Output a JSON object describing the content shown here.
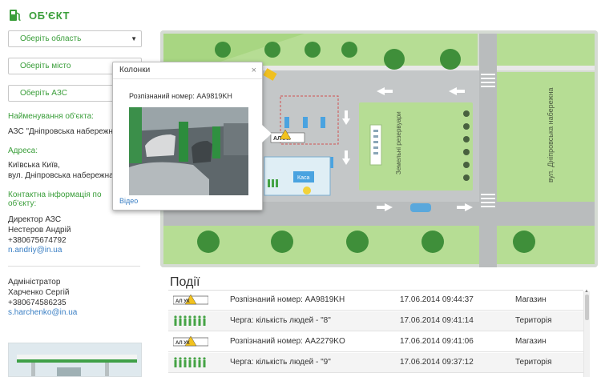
{
  "header": {
    "title": "ОБ'ЄКТ",
    "icon": "fuel-pump-icon",
    "accent": "#3a9e3a"
  },
  "filters": {
    "region": "Оберіть область",
    "city": "Оберіть місто",
    "station": "Оберіть АЗС"
  },
  "object": {
    "name_label": "Найменування об'єкта:",
    "name_value": "АЗС \"Дніпровська набережна\"",
    "address_label": "Адреса:",
    "address_line1": "Київська Київ,",
    "address_line2": "вул. Дніпровська набережна",
    "contacts_label_1": "Контактна інформація по",
    "contacts_label_2": "об'єкту:",
    "director_role": "Директор АЗС",
    "director_name": "Нестеров Андрій",
    "director_phone": "+380675674792",
    "director_email": "n.andriy@in.ua",
    "admin_role": "Адміністратор",
    "admin_name": "Харченко Сергій",
    "admin_phone": "+380674586235",
    "admin_email": "s.harchenko@in.ua"
  },
  "map": {
    "street_label": "вул. Дніпровська набережна",
    "tank_label": "Земельні резервуари",
    "kasa_label": "Каса",
    "logo_text": "АЛ УК"
  },
  "popup": {
    "title": "Колонки",
    "close": "×",
    "plate_label": "Розпізнаний номер:",
    "plate_value": "AA9819KH",
    "video_link": "Відео"
  },
  "events": {
    "title": "Події",
    "rows": [
      {
        "icon": "plate-camera-icon",
        "message": "Розпізнаний номер:  AA9819KH",
        "time": "17.06.2014 09:44:37",
        "location": "Магазин"
      },
      {
        "icon": "queue-people-icon",
        "message": "Черга: кількість людей - \"8\"",
        "time": "17.06.2014 09:41:14",
        "location": "Територія"
      },
      {
        "icon": "plate-camera-icon",
        "message": "Розпізнаний номер: AA2279KO",
        "time": "17.06.2014 09:41:06",
        "location": "Магазин"
      },
      {
        "icon": "queue-people-icon",
        "message": "Черга: кількість людей - \"9\"",
        "time": "17.06.2014 09:37:12",
        "location": "Територія"
      }
    ]
  }
}
